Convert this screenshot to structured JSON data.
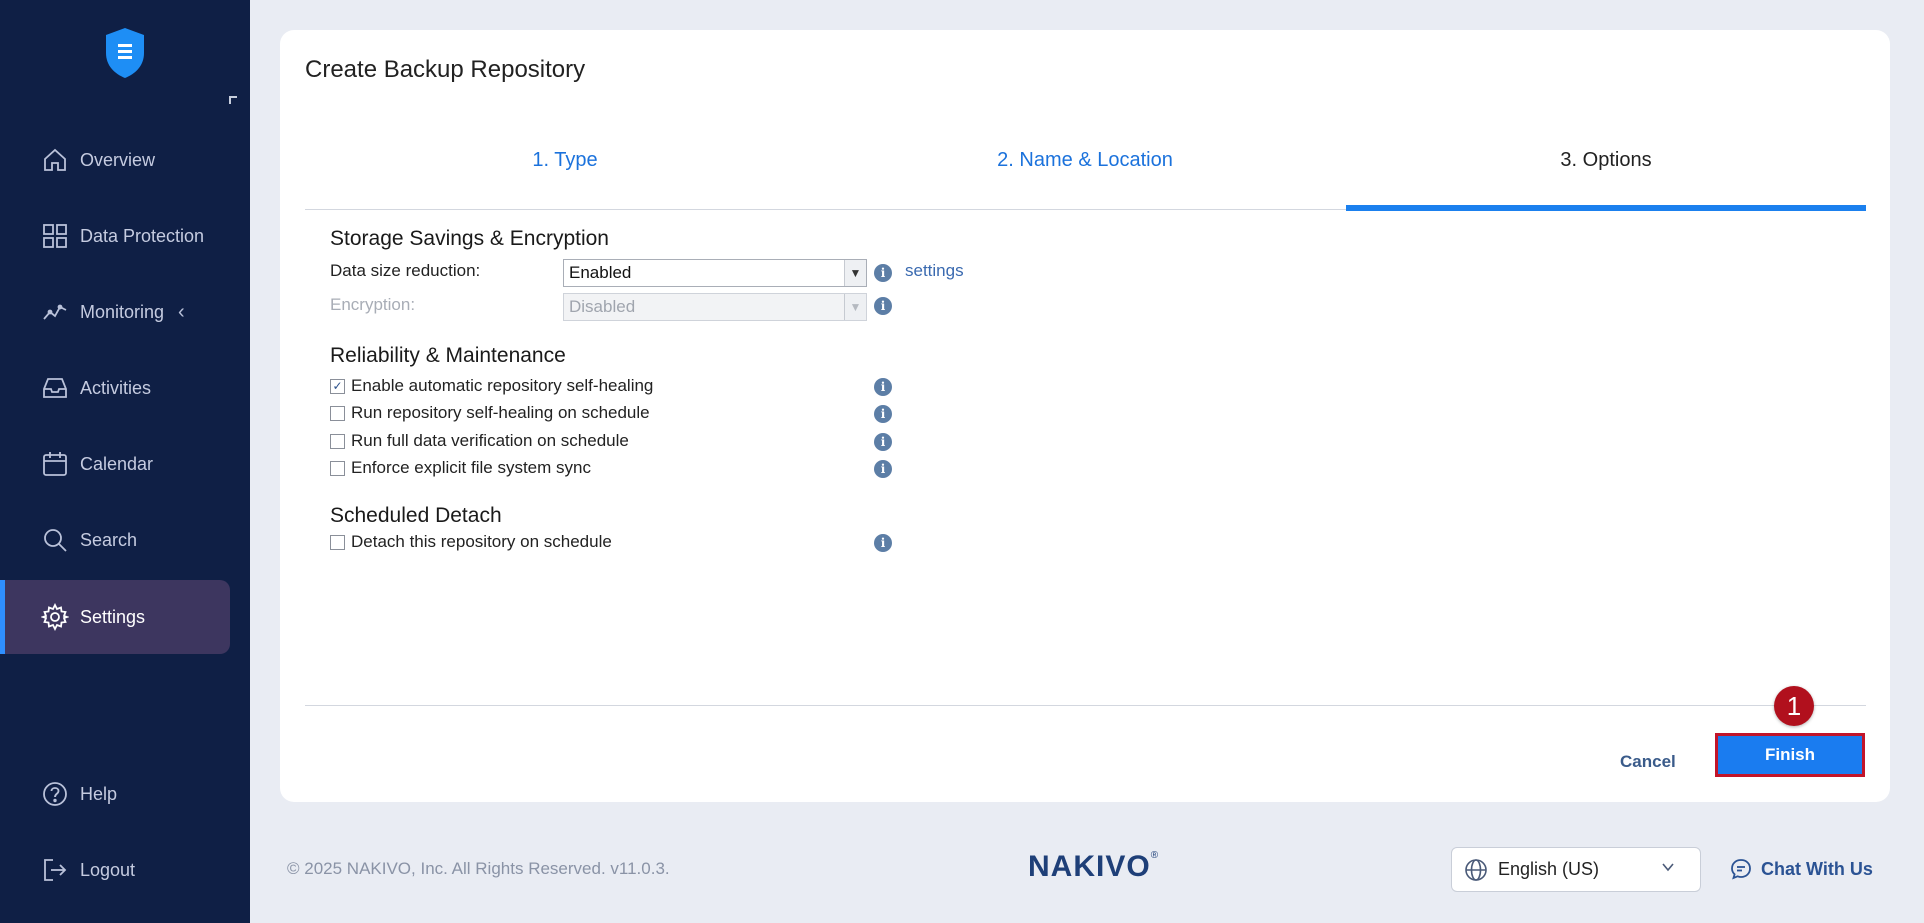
{
  "sidebar": {
    "items": [
      {
        "label": "Overview"
      },
      {
        "label": "Data Protection"
      },
      {
        "label": "Monitoring"
      },
      {
        "label": "Activities"
      },
      {
        "label": "Calendar"
      },
      {
        "label": "Search"
      },
      {
        "label": "Settings"
      },
      {
        "label": "Help"
      },
      {
        "label": "Logout"
      }
    ],
    "active": "Settings"
  },
  "wizard": {
    "title": "Create Backup Repository",
    "tabs": [
      {
        "label": "1. Type"
      },
      {
        "label": "2. Name & Location"
      },
      {
        "label": "3. Options"
      }
    ],
    "active_tab": "3. Options"
  },
  "storage": {
    "title": "Storage Savings & Encryption",
    "data_size_label": "Data size reduction:",
    "data_size_value": "Enabled",
    "settings_link": "settings",
    "encryption_label": "Encryption:",
    "encryption_value": "Disabled"
  },
  "reliability": {
    "title": "Reliability & Maintenance",
    "options": [
      {
        "label": "Enable automatic repository self-healing",
        "checked": true
      },
      {
        "label": "Run repository self-healing on schedule",
        "checked": false
      },
      {
        "label": "Run full data verification on schedule",
        "checked": false
      },
      {
        "label": "Enforce explicit file system sync",
        "checked": false
      }
    ]
  },
  "detach": {
    "title": "Scheduled Detach",
    "option": {
      "label": "Detach this repository on schedule",
      "checked": false
    }
  },
  "actions": {
    "cancel": "Cancel",
    "finish": "Finish",
    "badge": "1"
  },
  "footer": {
    "copyright": "© 2025 NAKIVO, Inc. All Rights Reserved. v11.0.3.",
    "brand": "NAKIVO",
    "brand_mark": "®",
    "language": "English (US)",
    "chat": "Chat With Us"
  },
  "colors": {
    "sidebar_bg": "#0f1f45",
    "active_nav_bg": "#3d365f",
    "accent": "#1a7cf0",
    "highlight_border": "#c2152a"
  }
}
